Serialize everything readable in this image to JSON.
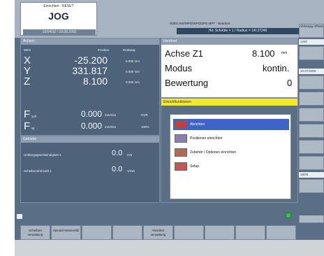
{
  "header": {
    "reset_label": "Einrichten · RESET",
    "mode": "JOG",
    "date": "10/04/32 / 29.09.2002",
    "path": "/N/ES.SW/WPD/WPD/SPD.MPF · Bearbeit",
    "program_status": "Hd: Schrittte = 1  /  Radius = 14/.37246"
  },
  "right_softkeys": [
    {
      "label": "Abhängig Affinitä"
    },
    {
      "label": ""
    },
    {
      "label": ""
    },
    {
      "label": ""
    },
    {
      "label": ""
    },
    {
      "label": ""
    },
    {
      "label": ""
    },
    {
      "label": ""
    },
    {
      "label": ""
    },
    {
      "label": "Alarm liste"
    }
  ],
  "right_values": [
    "1200",
    "10 07/2300",
    "18/00"
  ],
  "position_panel": {
    "title": "Achsen",
    "col_wks": "WKS",
    "col_position": "Position",
    "col_restweg": "Restweg",
    "axes": [
      {
        "name": "X",
        "value": "-25.200",
        "rest": "0.000 mm"
      },
      {
        "name": "Y",
        "value": "331.817",
        "rest": "0.000 mm"
      },
      {
        "name": "Z",
        "value": "8.100",
        "rest": "0.000 mm"
      }
    ],
    "feeds": [
      {
        "name": "F",
        "sub": "soll",
        "value": "0.000",
        "unit": "mm/min",
        "right": "OVR"
      },
      {
        "name": "F",
        "sub": "ist",
        "value": "0.000",
        "unit": "mm/min",
        "right": "100%"
      }
    ]
  },
  "gear_panel": {
    "title": "Getriebe",
    "rows": [
      {
        "label": "Umfangsgeschwindigkeit 1",
        "value": "0.0",
        "unit": "m/s"
      },
      {
        "label": "Scheibendrehzahl 1",
        "value": "0.0",
        "unit": "1/min"
      }
    ]
  },
  "info_panel": {
    "title": "Handrad",
    "rows": [
      {
        "label": "Achse Z1",
        "value": "8.100",
        "unit": "mm"
      },
      {
        "label": "Modus",
        "value": "kontin.",
        "unit": ""
      },
      {
        "label": "Bewertung",
        "value": "0",
        "unit": ""
      }
    ]
  },
  "popup": {
    "title": "Einrichtfunktionen",
    "items": [
      {
        "label": "Abrichten",
        "selected": true
      },
      {
        "label": "Positionen einrichten",
        "selected": false
      },
      {
        "label": "Zubehör / Optionen einrichten",
        "selected": false
      },
      {
        "label": "Setup",
        "selected": false
      }
    ]
  },
  "bottom_softkeys": [
    {
      "label": "Scheiben verwaltung"
    },
    {
      "label": "Spindel Steinmeldi"
    },
    {
      "label": ""
    },
    {
      "label": ""
    },
    {
      "label": "Abrichter verwaltung"
    },
    {
      "label": ""
    },
    {
      "label": ""
    },
    {
      "label": ""
    },
    {
      "label": ""
    }
  ],
  "colors": {
    "panel_blue": "#4e6279",
    "highlight": "#3f64c8",
    "popup_title": "#f2e92a",
    "status_green": "#38c24a"
  }
}
